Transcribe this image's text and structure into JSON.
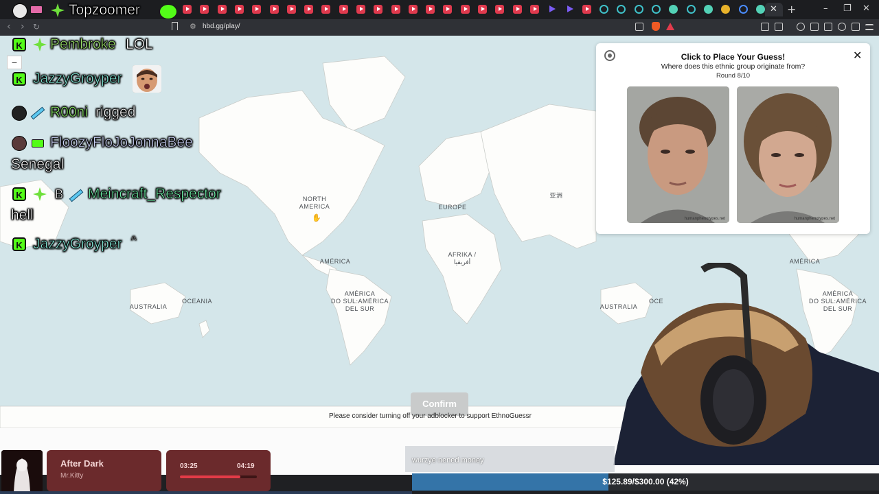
{
  "browser": {
    "url": "hbd.gg/play/"
  },
  "map": {
    "labels": [
      {
        "text": "NORTH\nAMERICA"
      },
      {
        "text": "EUROPE"
      },
      {
        "text": "亚洲"
      },
      {
        "text": "AFRIKA /\nأفريقيا"
      },
      {
        "text": "AMÉRICA"
      },
      {
        "text": "AMÉRICA\nDO SUL:AMÉRICA\nDEL SUR"
      },
      {
        "text": "AUSTRALIA"
      },
      {
        "text": "OCEANIA"
      },
      {
        "text": "AMÉRICA"
      },
      {
        "text": "AMÉRICA\nDO SUL:AMÉRICA\nDEL SUR"
      },
      {
        "text": "AUSTRALIA"
      },
      {
        "text": "OCE"
      }
    ],
    "zoom_out_label": "−"
  },
  "guess_panel": {
    "title": "Click to Place Your Guess!",
    "question": "Where does this ethnic group originate from?",
    "round": "Round 8/10",
    "close_label": "✕",
    "watermark": "humanphenotypes.net"
  },
  "confirm_label": "Confirm",
  "adblock_message": "Please consider turning off your adblocker to support EthnoGuessr",
  "chat": {
    "brand": "Topzoomer",
    "messages": [
      {
        "user": "Pembroke",
        "text": "LOL",
        "user_color": "#9be36a"
      },
      {
        "user": "JazzyGroyper",
        "text": "",
        "user_color": "#7fe0d0"
      },
      {
        "user": "R00ni",
        "text": "rigged",
        "user_color": "#8dea6a"
      },
      {
        "user": "FloozyFloJoJonnaBee",
        "text": "Senegal",
        "user_color": "#c8d0f4"
      },
      {
        "user": "Meincraft_Respector",
        "text": "hell",
        "user_color": "#6ff0a8",
        "badge_letter": "B"
      },
      {
        "user": "JazzyGroyper",
        "text": "^",
        "user_color": "#7fe0d0"
      }
    ]
  },
  "music": {
    "title": "After Dark",
    "artist": "Mr.Kitty",
    "current": "03:25",
    "total": "04:19",
    "progress": 0.79
  },
  "subtitle": "wurzye nened money",
  "goal": {
    "text": "$125.89/$300.00 (42%)",
    "fraction": 0.42
  },
  "colors": {
    "ocean": "#d4e6ea",
    "land": "#fdfdfb",
    "goal_fill": "#3474a8",
    "kick_green": "#53fc18"
  }
}
